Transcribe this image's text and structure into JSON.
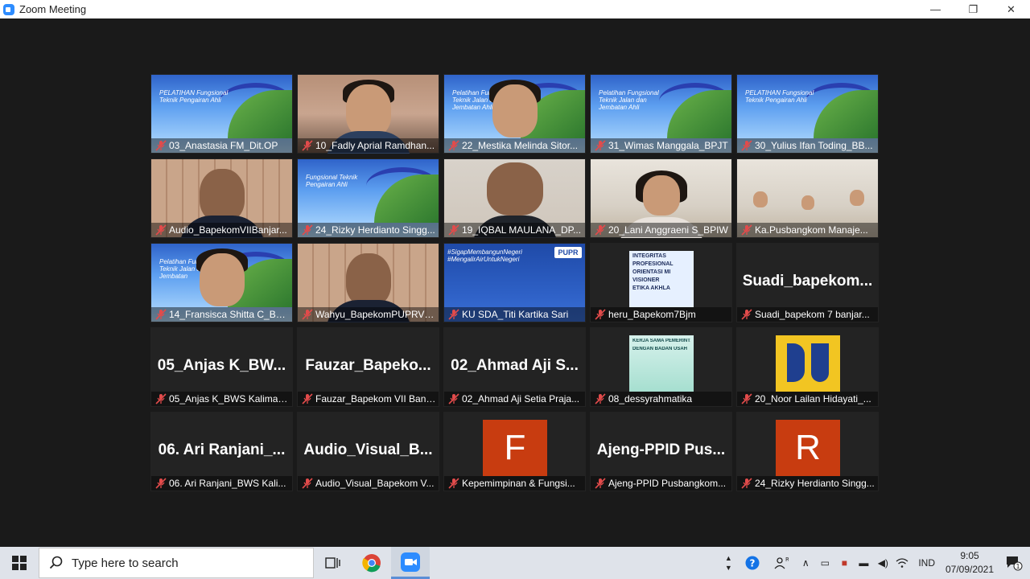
{
  "window": {
    "title": "Zoom Meeting",
    "minimize_glyph": "—",
    "restore_glyph": "❐",
    "close_glyph": "✕"
  },
  "tiles": [
    {
      "name": "03_Anastasia FM_Dit.OP",
      "type": "slide",
      "slide_text": "PELATIHAN Fungsional Teknik Pengairan Ahli"
    },
    {
      "name": "10_Fadly Aprial Ramdhan...",
      "type": "camera-office"
    },
    {
      "name": "22_Mestika Melinda Sitor...",
      "type": "slide-face",
      "slide_text": "Pelatihan Fungsional Teknik Jalan dan Jembatan Ahli"
    },
    {
      "name": "31_Wimas Manggala_BPJT",
      "type": "slide",
      "slide_text": "Pelatihan Fungsional Teknik Jalan dan Jembatan Ahli"
    },
    {
      "name": "30_Yulius Ifan Toding_BB...",
      "type": "slide",
      "slide_text": "PELATIHAN Fungsional Teknik Pengairan Ahli"
    },
    {
      "name": "Audio_BapekomVIIBanjar...",
      "type": "camera-lockers"
    },
    {
      "name": "24_Rizky Herdianto Singg...",
      "type": "slide",
      "slide_text": "Fungsional Teknik Pengairan Ahli"
    },
    {
      "name": "19_IQBAL MAULANA_DP...",
      "type": "camera-wall"
    },
    {
      "name": "20_Lani Anggraeni S_BPIW",
      "type": "camera-room"
    },
    {
      "name": "Ka.Pusbangkom Manaje...",
      "type": "camera-room2"
    },
    {
      "name": "14_Fransisca Shitta C_BPJ...",
      "type": "slide-face",
      "slide_text": "Pelatihan Fungsional Teknik Jalan dan Jembatan"
    },
    {
      "name": "Wahyu_BapekomPUPRVII...",
      "type": "camera-lockers"
    },
    {
      "name": "KU SDA_Titi Kartika Sari",
      "type": "kusda",
      "tag": "#SigapMembangunNegeri #MengalirAirUntukNegeri",
      "logo": "PUPR"
    },
    {
      "name": "heru_Bapekom7Bjm",
      "type": "poster",
      "lines": [
        "INTEGRITAS",
        "PROFESIONAL",
        "ORIENTASI MI",
        "VISIONER",
        "ETIKA AKHLA"
      ]
    },
    {
      "name": "Suadi_bapekom 7 banjar...",
      "type": "bigname",
      "big": "Suadi_bapekom..."
    },
    {
      "name": "05_Anjas K_BWS Kaliman...",
      "type": "bigname",
      "big": "05_Anjas K_BW..."
    },
    {
      "name": "Fauzar_Bapekom VII Banj...",
      "type": "bigname",
      "big": "Fauzar_Bapeko..."
    },
    {
      "name": "02_Ahmad Aji Setia Praja...",
      "type": "bigname",
      "big": "02_Ahmad Aji S..."
    },
    {
      "name": "08_dessyrahmatika",
      "type": "poster2",
      "lines": [
        "KERJA SAMA PEMERINTA",
        "DENGAN BADAN USAH"
      ]
    },
    {
      "name": "20_Noor Lailan Hidayati_...",
      "type": "pulogo"
    },
    {
      "name": "06. Ari Ranjani_BWS Kali...",
      "type": "bigname",
      "big": "06. Ari Ranjani_..."
    },
    {
      "name": "Audio_Visual_Bapekom V...",
      "type": "bigname",
      "big": "Audio_Visual_B..."
    },
    {
      "name": "Kepemimpinan & Fungsi...",
      "type": "avatar",
      "letter": "F",
      "color": "#c83c10"
    },
    {
      "name": "Ajeng-PPID Pusbangkom...",
      "type": "bigname",
      "big": "Ajeng-PPID Pus..."
    },
    {
      "name": "24_Rizky Herdianto Singg...",
      "type": "avatar",
      "letter": "R",
      "color": "#c83c10"
    }
  ],
  "taskbar": {
    "search_placeholder": "Type here to search",
    "language": "IND",
    "time": "9:05",
    "date": "07/09/2021",
    "notification_count": "1"
  }
}
